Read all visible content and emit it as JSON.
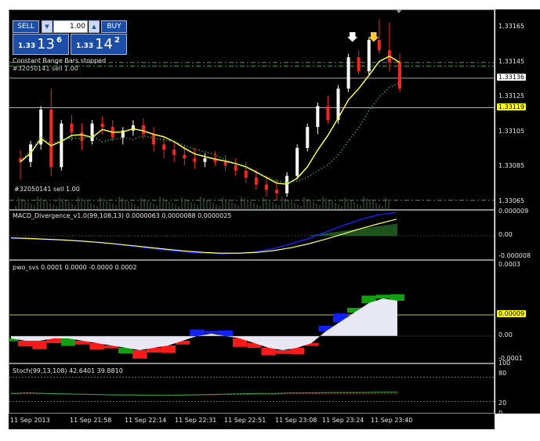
{
  "chart_data": [
    {
      "type": "candlestick",
      "title": "",
      "ylim": [
        1.3306,
        1.33175
      ],
      "yticks": [
        "1.33165",
        "1.33145",
        "1.33125",
        "1.33105",
        "1.33085",
        "1.33065"
      ],
      "price_tags": [
        {
          "label": "1.33136",
          "value": 1.33136,
          "bg": "#ffffff",
          "fg": "#000000"
        },
        {
          "label": "1.33119",
          "value": 1.33119,
          "bg": "#ffff00",
          "fg": "#000000"
        }
      ],
      "annotations": {
        "status_text": "Constant Range Bars stopped",
        "order_text": "#32050141 sell 1.00",
        "partial_text": "#32050141 sell 1.00"
      },
      "trade_panel": {
        "sell_label": "SELL",
        "buy_label": "BUY",
        "lot": "1.00",
        "sell_prefix": "1.33",
        "sell_big": "13",
        "sell_sup": "6",
        "buy_prefix": "1.33",
        "buy_big": "14",
        "buy_sup": "2"
      },
      "candles": [
        [
          1.3309,
          1.33095,
          1.33078,
          1.33088
        ],
        [
          1.33088,
          1.331,
          1.33085,
          1.33098
        ],
        [
          1.33098,
          1.3312,
          1.33095,
          1.33118
        ],
        [
          1.33118,
          1.3313,
          1.3308,
          1.33085
        ],
        [
          1.33085,
          1.33112,
          1.33083,
          1.3311
        ],
        [
          1.3311,
          1.33115,
          1.331,
          1.33105
        ],
        [
          1.33105,
          1.3311,
          1.33095,
          1.331
        ],
        [
          1.331,
          1.33112,
          1.33098,
          1.3311
        ],
        [
          1.3311,
          1.33114,
          1.33104,
          1.33108
        ],
        [
          1.33108,
          1.33112,
          1.331,
          1.33102
        ],
        [
          1.33102,
          1.33108,
          1.33098,
          1.33106
        ],
        [
          1.33106,
          1.33112,
          1.33103,
          1.33109
        ],
        [
          1.33109,
          1.33113,
          1.33101,
          1.33104
        ],
        [
          1.33104,
          1.33108,
          1.33094,
          1.33098
        ],
        [
          1.33098,
          1.33102,
          1.3309,
          1.33095
        ],
        [
          1.33095,
          1.331,
          1.33088,
          1.33092
        ],
        [
          1.33092,
          1.33098,
          1.33086,
          1.3309
        ],
        [
          1.3309,
          1.33096,
          1.33084,
          1.33088
        ],
        [
          1.33088,
          1.33093,
          1.33085,
          1.3309
        ],
        [
          1.3309,
          1.33094,
          1.33086,
          1.33088
        ],
        [
          1.33088,
          1.33092,
          1.33083,
          1.33086
        ],
        [
          1.33086,
          1.3309,
          1.3308,
          1.33083
        ],
        [
          1.33083,
          1.33088,
          1.33076,
          1.33079
        ],
        [
          1.33079,
          1.33084,
          1.33072,
          1.33075
        ],
        [
          1.33075,
          1.3308,
          1.33068,
          1.33072
        ],
        [
          1.33072,
          1.33078,
          1.33066,
          1.3307
        ],
        [
          1.3307,
          1.33082,
          1.33068,
          1.3308
        ],
        [
          1.3308,
          1.33098,
          1.33078,
          1.33096
        ],
        [
          1.33096,
          1.3311,
          1.33094,
          1.33108
        ],
        [
          1.33108,
          1.33122,
          1.33104,
          1.3312
        ],
        [
          1.3312,
          1.33126,
          1.3311,
          1.33112
        ],
        [
          1.33112,
          1.33132,
          1.3311,
          1.3313
        ],
        [
          1.3313,
          1.3315,
          1.33128,
          1.33148
        ],
        [
          1.33148,
          1.33152,
          1.33138,
          1.3314
        ],
        [
          1.3314,
          1.3316,
          1.33138,
          1.33158
        ],
        [
          1.33158,
          1.3317,
          1.3315,
          1.33152
        ],
        [
          1.33152,
          1.33168,
          1.3314,
          1.33145
        ],
        [
          1.33145,
          1.3315,
          1.33128,
          1.3313
        ]
      ]
    },
    {
      "type": "line",
      "title": "MACD_Divergence_v1.0(99,108,13) 0.0000063 0.0000088 0.0000025",
      "ylim": [
        -9.5e-06,
        9.5e-06
      ],
      "yticks": [
        "0.000009",
        "0.00",
        "-0.000008"
      ],
      "macd": [
        -1e-06,
        -1.2e-06,
        -1.4e-06,
        -1.6e-06,
        -2e-06,
        -2.5e-06,
        -3.2e-06,
        -4e-06,
        -4.8e-06,
        -5.6e-06,
        -6.2e-06,
        -6.6e-06,
        -6.8e-06,
        -6.6e-06,
        -6e-06,
        -4.8e-06,
        -3e-06,
        -1e-06,
        1.5e-06,
        4e-06,
        6.3e-06,
        8e-06,
        8.8e-06
      ],
      "signal": [
        -8e-07,
        -1e-06,
        -1.3e-06,
        -1.6e-06,
        -2e-06,
        -2.5e-06,
        -3.1e-06,
        -3.8e-06,
        -4.5e-06,
        -5.2e-06,
        -5.8e-06,
        -6.3e-06,
        -6.6e-06,
        -6.6e-06,
        -6.3e-06,
        -5.6e-06,
        -4.5e-06,
        -3e-06,
        -1.2e-06,
        8e-07,
        2.8e-06,
        4.6e-06,
        6.3e-06
      ]
    },
    {
      "type": "area",
      "title": "pwo_svs 0.0001 0.0000 -0.0000 0.0002",
      "ylim": [
        -0.00012,
        0.00032
      ],
      "yticks": [
        "0.0003",
        "0.00",
        "-0.0001"
      ],
      "price_tags": [
        {
          "label": "0.00009",
          "value": 9e-05,
          "bg": "#ffff00",
          "fg": "#000000"
        }
      ],
      "values": [
        -1e-05,
        -2e-05,
        -2e-05,
        -1e-05,
        -1e-05,
        -2e-05,
        -3e-05,
        -4e-05,
        -5e-05,
        -6e-05,
        -5e-05,
        -4e-05,
        -2e-05,
        0.0,
        1e-05,
        0.0,
        -1e-05,
        -3e-05,
        -5e-05,
        -6e-05,
        -5e-05,
        -3e-05,
        2e-05,
        6e-05,
        0.0001,
        0.00014,
        0.00016,
        0.00015
      ]
    },
    {
      "type": "line",
      "title": "Stoch(99,13,108) 42.6401 39.8810",
      "ylim": [
        0,
        100
      ],
      "yticks": [
        "100",
        "80",
        "20",
        "0"
      ],
      "main": [
        40,
        41,
        40,
        39,
        38,
        37,
        36,
        36,
        35,
        35,
        36,
        37,
        38,
        39,
        40,
        40,
        41,
        41,
        42,
        42,
        42,
        43,
        43
      ],
      "signal": [
        39,
        39,
        39,
        38,
        38,
        37,
        37,
        36,
        36,
        36,
        36,
        36,
        37,
        37,
        38,
        38,
        39,
        39,
        40,
        40,
        40,
        40,
        40
      ]
    }
  ],
  "time_axis": [
    "11 Sep 2013",
    "11 Sep 21:58",
    "11 Sep 22:14",
    "11 Sep 22:31",
    "11 Sep 22:51",
    "11 Sep 23:08",
    "11 Sep 23:24",
    "11 Sep 23:40"
  ],
  "colors": {
    "bull": "#ffffff",
    "bear": "#ff2020",
    "ma": "#ffff33",
    "dots": "#35d14a",
    "macd": "#1020ff",
    "signal": "#ffff66",
    "pwo_red": "#ff1a1a",
    "pwo_blue": "#1020ff",
    "pwo_green": "#10a010",
    "pwo_fill": "#e8e8f5"
  }
}
